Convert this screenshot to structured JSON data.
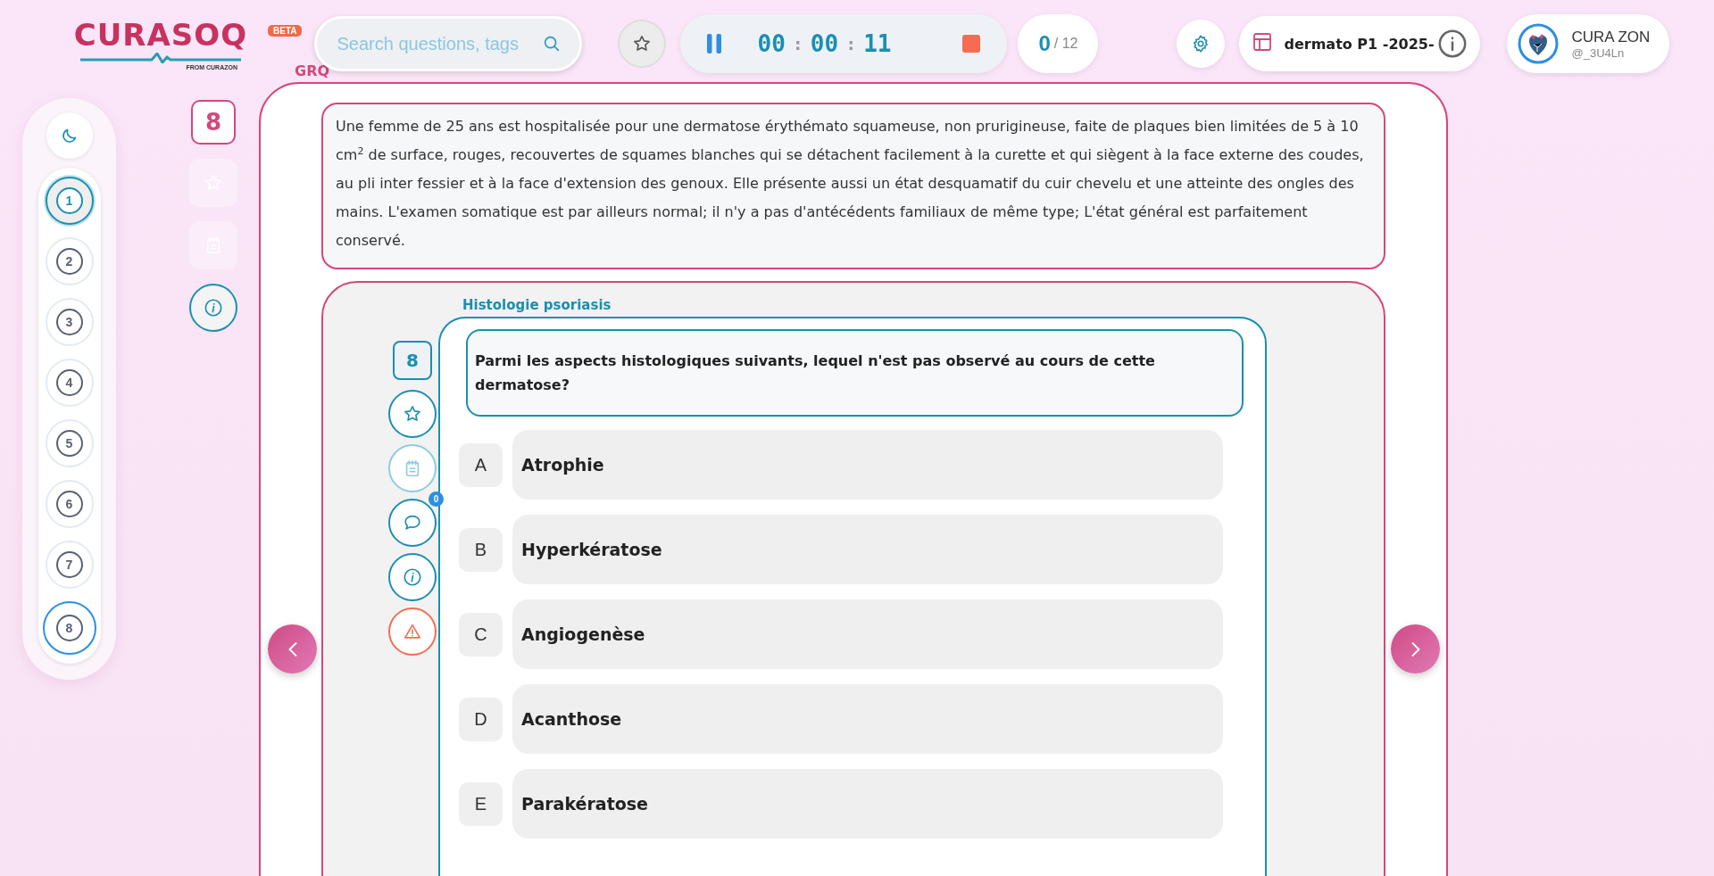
{
  "header": {
    "logo": "CURASOQ",
    "logo_subtitle": "FROM CURAZON",
    "badge": "BETA",
    "search": {
      "placeholder": "Search questions, tags"
    },
    "timer": [
      {
        "kind": "digits",
        "text": "00"
      },
      {
        "kind": "separator",
        "text": ":"
      },
      {
        "kind": "digits",
        "text": "00"
      },
      {
        "kind": "separator",
        "text": ":"
      },
      {
        "kind": "digits",
        "text": "11"
      }
    ],
    "progress": {
      "answered": "0",
      "total": "/ 12"
    },
    "exam": {
      "title": "dermato P1 -2025-"
    },
    "user": {
      "name": "CURA ZON",
      "handle": "@_3U4Ln"
    }
  },
  "section_label": "GRQ",
  "question_nav": [
    {
      "label": "1",
      "selected": true,
      "current": false
    },
    {
      "label": "2",
      "selected": false,
      "current": false
    },
    {
      "label": "3",
      "selected": false,
      "current": false
    },
    {
      "label": "4",
      "selected": false,
      "current": false
    },
    {
      "label": "5",
      "selected": false,
      "current": false
    },
    {
      "label": "6",
      "selected": false,
      "current": false
    },
    {
      "label": "7",
      "selected": false,
      "current": false
    },
    {
      "label": "8",
      "selected": false,
      "current": true
    }
  ],
  "side_panel": {
    "question_number": "8",
    "tools": [
      {
        "kind": "star",
        "disabled": true
      },
      {
        "kind": "notes",
        "disabled": true
      },
      {
        "kind": "info",
        "disabled": false
      }
    ]
  },
  "case_text": "Une femme de 25 ans est hospitalisée pour une dermatose érythémato squameuse, non prurigineuse, faite de plaques bien limitées de 5 à 10 cm$^{2}$ de surface, rouges, recouvertes de squames blanches qui se détachent facilement à la curette et qui siègent à la face externe des coudes, au pli inter fessier et à la face d'extension des genoux. Elle présente aussi un état desquamatif du cuir chevelu et une atteinte des ongles des mains. L'examen somatique est par ailleurs normal; il n'y a pas d'antécédents familiaux de même type; L'état général est parfaitement conservé.",
  "question": {
    "topic": "Histologie psoriasis",
    "number": "8",
    "tools": [
      {
        "kind": "star",
        "disabled": false
      },
      {
        "kind": "notes",
        "disabled": true
      },
      {
        "kind": "comments",
        "disabled": false,
        "badge": "0"
      },
      {
        "kind": "info",
        "disabled": false
      },
      {
        "kind": "report",
        "disabled": false
      }
    ],
    "text": "Parmi les aspects histologiques suivants, lequel n'est pas observé au cours de cette dermatose?",
    "options": [
      {
        "letter": "A",
        "text": "Atrophie",
        "selected": false
      },
      {
        "letter": "B",
        "text": "Hyperkératose",
        "selected": false
      },
      {
        "letter": "C",
        "text": "Angiogenèse",
        "selected": false
      },
      {
        "letter": "D",
        "text": "Acanthose",
        "selected": false
      },
      {
        "letter": "E",
        "text": "Parakératose",
        "selected": false
      }
    ]
  }
}
